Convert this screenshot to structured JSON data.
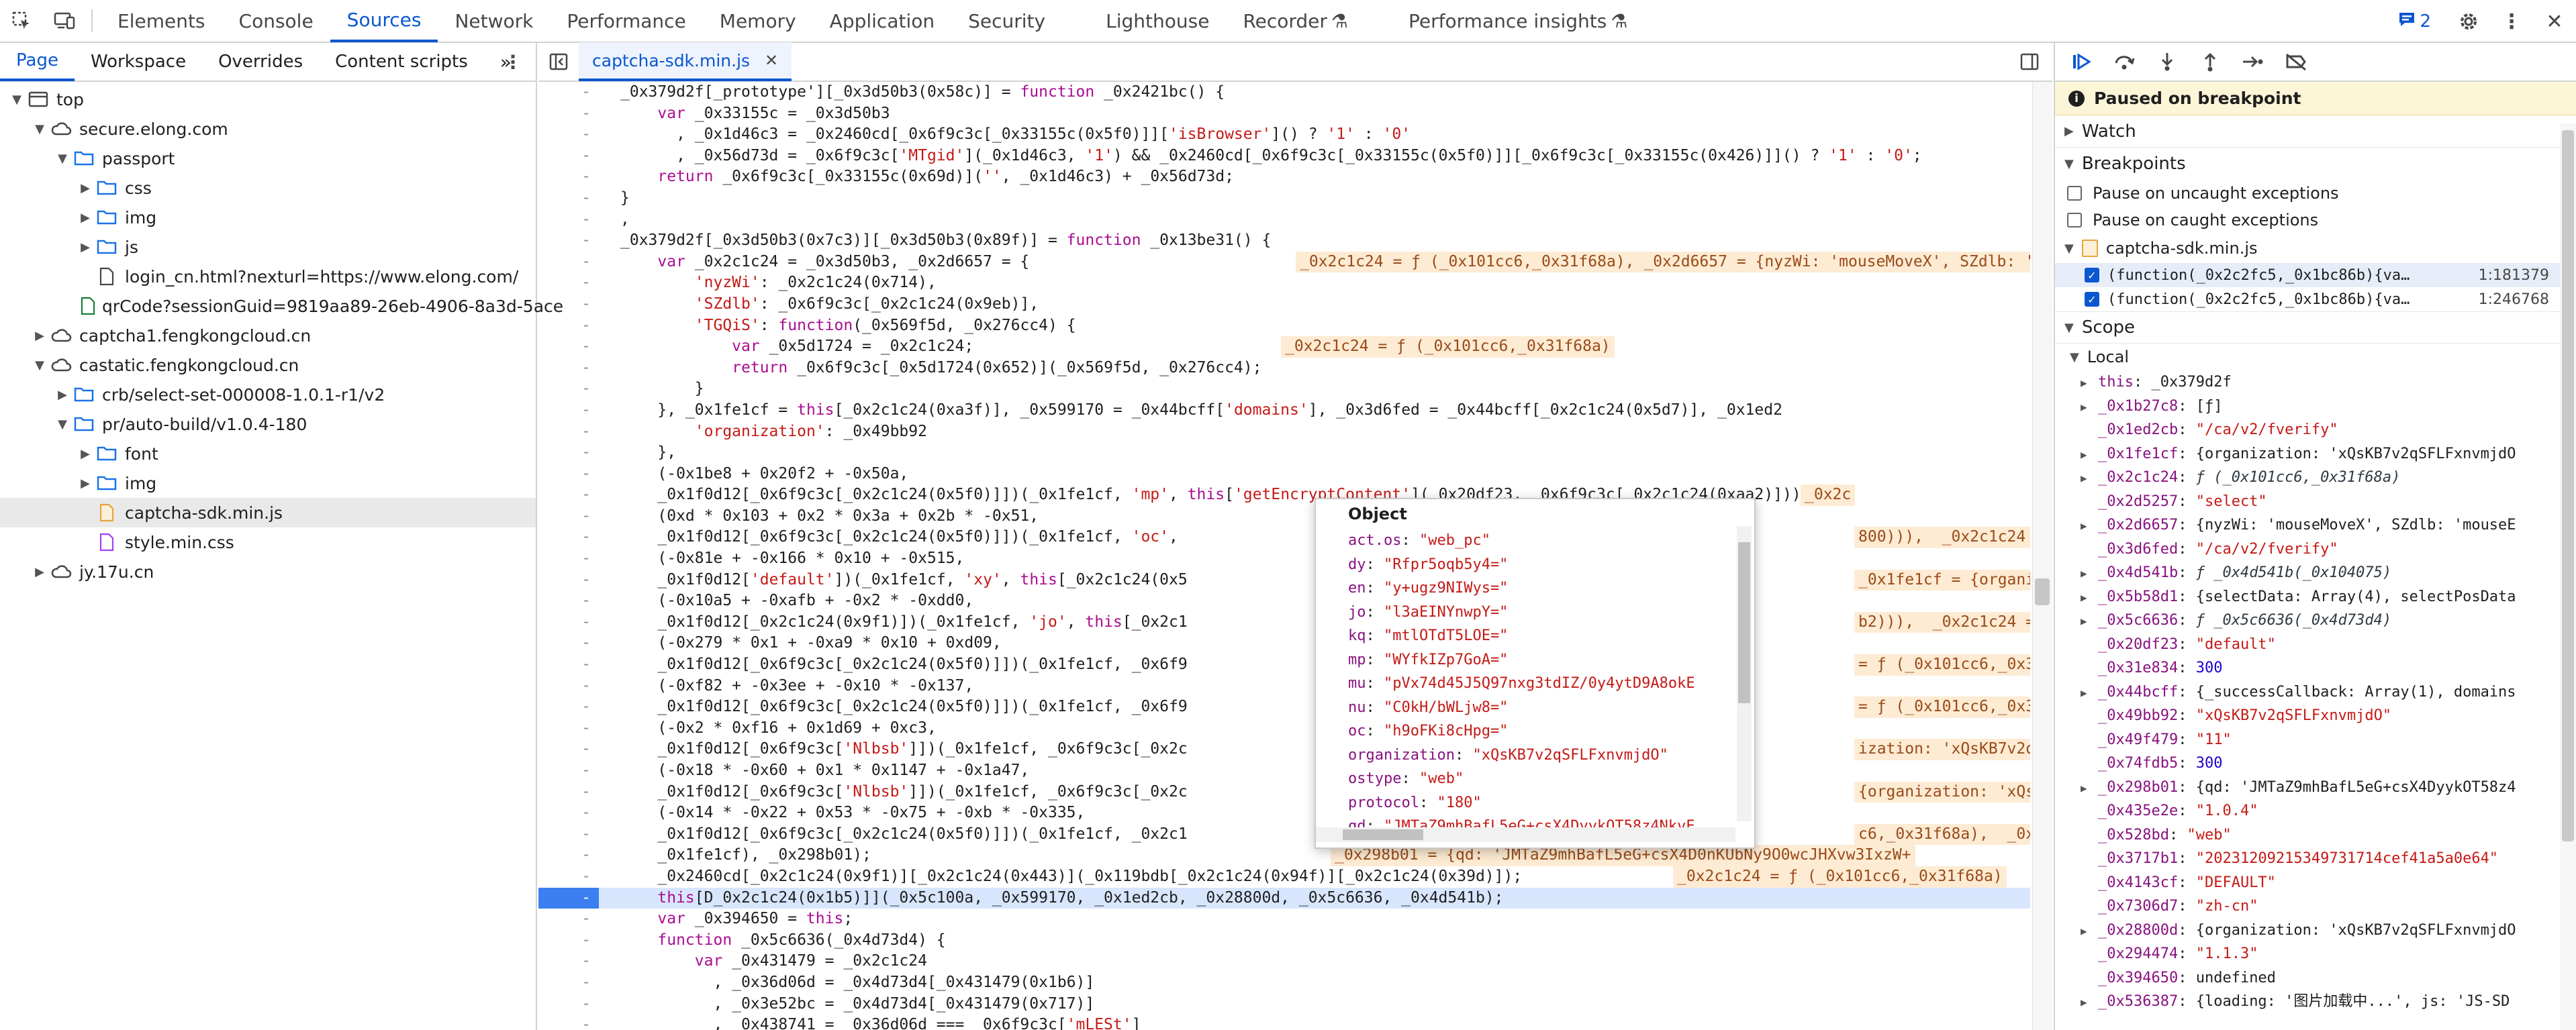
{
  "toolbar": {
    "tabs": [
      "Elements",
      "Console",
      "Sources",
      "Network",
      "Performance",
      "Memory",
      "Application",
      "Security",
      "Lighthouse",
      "Recorder",
      "Performance insights"
    ],
    "active_tab": "Sources",
    "issues_count": "2"
  },
  "navigator": {
    "tabs": [
      "Page",
      "Workspace",
      "Overrides",
      "Content scripts"
    ],
    "tree": [
      {
        "label": "top",
        "depth": 0,
        "arrow": "▼",
        "icon": "frame"
      },
      {
        "label": "secure.elong.com",
        "depth": 1,
        "arrow": "▼",
        "icon": "cloud"
      },
      {
        "label": "passport",
        "depth": 2,
        "arrow": "▼",
        "icon": "folder"
      },
      {
        "label": "css",
        "depth": 3,
        "arrow": "▶",
        "icon": "folder"
      },
      {
        "label": "img",
        "depth": 3,
        "arrow": "▶",
        "icon": "folder"
      },
      {
        "label": "js",
        "depth": 3,
        "arrow": "▶",
        "icon": "folder"
      },
      {
        "label": "login_cn.html?nexturl=https://www.elong.com/",
        "depth": 3,
        "arrow": "",
        "icon": "file"
      },
      {
        "label": "qrCode?sessionGuid=9819aa89-26eb-4906-8a3d-5ace",
        "depth": 3,
        "arrow": "",
        "icon": "file-green"
      },
      {
        "label": "captcha1.fengkongcloud.cn",
        "depth": 1,
        "arrow": "▶",
        "icon": "cloud"
      },
      {
        "label": "castatic.fengkongcloud.cn",
        "depth": 1,
        "arrow": "▼",
        "icon": "cloud"
      },
      {
        "label": "crb/select-set-000008-1.0.1-r1/v2",
        "depth": 2,
        "arrow": "▶",
        "icon": "folder"
      },
      {
        "label": "pr/auto-build/v1.0.4-180",
        "depth": 2,
        "arrow": "▼",
        "icon": "folder"
      },
      {
        "label": "font",
        "depth": 3,
        "arrow": "▶",
        "icon": "folder"
      },
      {
        "label": "img",
        "depth": 3,
        "arrow": "▶",
        "icon": "folder"
      },
      {
        "label": "captcha-sdk.min.js",
        "depth": 3,
        "arrow": "",
        "icon": "file-js",
        "selected": true
      },
      {
        "label": "style.min.css",
        "depth": 3,
        "arrow": "",
        "icon": "file-css"
      },
      {
        "label": "jy.17u.cn",
        "depth": 1,
        "arrow": "▶",
        "icon": "cloud"
      }
    ]
  },
  "editor": {
    "file_tab": "captcha-sdk.min.js",
    "gutter_mark": "-",
    "lines": [
      "_0x379d2f[_prototype'][_0x3d50b3(0x58c)] = function _0x2421bc() {",
      "    var _0x33155c = _0x3d50b3",
      "      , _0x1d46c3 = _0x2460cd[_0x6f9c3c[_0x33155c(0x5f0)]]['isBrowser']() ? '1' : '0'",
      "      , _0x56d73d = _0x6f9c3c['MTgid'](_0x1d46c3, '1') && _0x2460cd[_0x6f9c3c[_0x33155c(0x5f0)]][_0x6f9c3c[_0x33155c(0x426)]]() ? '1' : '0';",
      "    return _0x6f9c3c[_0x33155c(0x69d)]('', _0x1d46c3) + _0x56d73d;",
      "}",
      ",",
      "_0x379d2f[_0x3d50b3(0x7c3)][_0x3d50b3(0x89f)] = function _0x13be31() {",
      "    var _0x2c1c24 = _0x3d50b3, _0x2d6657 = {",
      "        'nyzWi': _0x2c1c24(0x714),",
      "        'SZdlb': _0x6f9c3c[_0x2c1c24(0x9eb)],",
      "        'TGQiS': function(_0x569f5d, _0x276cc4) {",
      "            var _0x5d1724 = _0x2c1c24;",
      "            return _0x6f9c3c[_0x5d1724(0x652)](_0x569f5d, _0x276cc4);",
      "        }",
      "    }, _0x1fe1cf = this[_0x2c1c24(0xa3f)], _0x599170 = _0x44bcff['domains'], _0x3d6fed = _0x44bcff[_0x2c1c24(0x5d7)], _0x1ed2",
      "        'organization': _0x49bb92",
      "    },",
      "    (-0x1be8 + 0x20f2 + -0x50a,",
      "    _0x1f0d12[_0x6f9c3c[_0x2c1c24(0x5f0)]])(_0x1fe1cf, 'mp', this['getEncryptContent'](_0x20df23, _0x6f9c3c[_0x2c1c24(0xaa2)])),",
      "    (0xd * 0x103 + 0x2 * 0x3a + 0x2b * -0x51,",
      "    _0x1f0d12[_0x6f9c3c[_0x2c1c24(0x5f0)]])(_0x1fe1cf, 'oc',",
      "    (-0x81e + -0x166 * 0x10 + -0x515,",
      "    _0x1f0d12['default'])(_0x1fe1cf, 'xy', this[_0x2c1c24(0x5",
      "    (-0x10a5 + -0xafb + -0x2 * -0xdd0,",
      "    _0x1f0d12[_0x2c1c24(0x9f1)])(_0x1fe1cf, 'jo', this[_0x2c1",
      "    (-0x279 * 0x1 + -0xa9 * 0x10 + 0xd09,",
      "    _0x1f0d12[_0x6f9c3c[_0x2c1c24(0x5f0)]])(_0x1fe1cf, _0x6f9",
      "    (-0xf82 + -0x3ee + -0x10 * -0x137,",
      "    _0x1f0d12[_0x6f9c3c[_0x2c1c24(0x5f0)]])(_0x1fe1cf, _0x6f9",
      "    (-0x2 * 0xf16 + 0x1d69 + 0xc3,",
      "    _0x1f0d12[_0x6f9c3c['Nlbsb']])(_0x1fe1cf, _0x6f9c3c[_0x2c",
      "    (-0x18 * -0x60 + 0x1 * 0x1147 + -0x1a47,",
      "    _0x1f0d12[_0x6f9c3c['Nlbsb']])(_0x1fe1cf, _0x6f9c3c[_0x2c",
      "    (-0x14 * -0x22 + 0x53 * -0x75 + -0xb * -0x335,",
      "    _0x1f0d12[_0x6f9c3c[_0x2c1c24(0x5f0)]])(_0x1fe1cf, _0x2c1",
      "    _0x1fe1cf), _0x298b01);",
      "    _0x2460cd[_0x2c1c24(0x9f1)][_0x2c1c24(0x443)](_0x119bdb[_0x2c1c24(0x94f)][_0x2c1c24(0x39d)]);",
      "    this[D_0x2c1c24(0x1b5)]](_0x5c100a, _0x599170, _0x1ed2cb, _0x28800d, _0x5c6636, _0x4d541b);",
      "    var _0x394650 = this;",
      "    function _0x5c6636(_0x4d73d4) {",
      "        var _0x431479 = _0x2c1c24",
      "          , _0x36d06d = _0x4d73d4[_0x431479(0x1b6)]",
      "          , _0x3e52bc = _0x4d73d4[_0x431479(0x717)]",
      "          , _0x438741 = _0x36d06d === _0x6f9c3c['mLESt']"
    ],
    "inline_values": [
      {
        "line": 8,
        "text": "_0x2c1c24 = ƒ (_0x101cc6,_0x31f68a), _0x2d6657 = {nyzWi: 'mouseMoveX', SZdlb: 'mouseEndX'"
      },
      {
        "line": 12,
        "text": "_0x2c1c24 = ƒ (_0x101cc6,_0x31f68a)"
      },
      {
        "line": 19,
        "text": "_0x2c"
      },
      {
        "line": 21,
        "text": "800))),  _0x2c1c24 = ƒ (_0x1"
      },
      {
        "line": 23,
        "text": "_0x1fe1cf = {organization:"
      },
      {
        "line": 25,
        "text": "b2))),  _0x2c1c24 = ƒ (_0x1"
      },
      {
        "line": 27,
        "text": "= ƒ (_0x101cc6,_0x31f68a),  _0x2"
      },
      {
        "line": 29,
        "text": "= ƒ (_0x101cc6,_0x31f68a),  _0x2"
      },
      {
        "line": 31,
        "text": "ization: 'xQsKB7v2qSFLFxnvmjd"
      },
      {
        "line": 33,
        "text": "{organization: 'xQsKB7v2qSFL"
      },
      {
        "line": 35,
        "text": "c6,_0x31f68a),  _0x1fe1cf = {"
      },
      {
        "line": 36,
        "text": "_0x298b01 = {qd: 'JMTaZ9mhBafL5eG+csX4D0nKUbNy9O0wcJHXvw3IxzW+"
      },
      {
        "line": 37,
        "text": "_0x2c1c24 = ƒ (_0x101cc6,_0x31f68a)"
      }
    ]
  },
  "popover": {
    "title": "Object",
    "rows": [
      {
        "k": "act.os",
        "v": "\"web_pc\""
      },
      {
        "k": "dy",
        "v": "\"Rfpr5oqb5y4=\""
      },
      {
        "k": "en",
        "v": "\"y+ugz9NIWys=\""
      },
      {
        "k": "jo",
        "v": "\"l3aEINYnwpY=\""
      },
      {
        "k": "kq",
        "v": "\"mtlOTdT5LOE=\""
      },
      {
        "k": "mp",
        "v": "\"WYfkIZp7GoA=\""
      },
      {
        "k": "mu",
        "v": "\"pVx74d45J5Q97nxg3tdIZ/0y4ytD9A8okE"
      },
      {
        "k": "nu",
        "v": "\"C0kH/bWLjw8=\""
      },
      {
        "k": "oc",
        "v": "\"h9oFKi8cHpg=\""
      },
      {
        "k": "organization",
        "v": "\"xQsKB7v2qSFLFxnvmjdO\""
      },
      {
        "k": "ostype",
        "v": "\"web\""
      },
      {
        "k": "protocol",
        "v": "\"180\""
      },
      {
        "k": "qd",
        "v": "\"JMTaZ9mhBafL5eG+csX4DyykOT58z4NkvE"
      }
    ]
  },
  "debugger": {
    "paused_text": "Paused on breakpoint",
    "watch_label": "Watch",
    "breakpoints_label": "Breakpoints",
    "pause_uncaught": "Pause on uncaught exceptions",
    "pause_caught": "Pause on caught exceptions",
    "bp_file": "captcha-sdk.min.js",
    "bp_entries": [
      {
        "code": "(function(_0x2c2fc5,_0x1bc86b){va…",
        "loc": "1:181379"
      },
      {
        "code": "(function(_0x2c2fc5,_0x1bc86b){va…",
        "loc": "1:246768"
      }
    ],
    "scope_label": "Scope",
    "local_label": "Local",
    "scope": [
      {
        "arrow": "▶",
        "k": "this",
        "v": "_0x379d2f",
        "t": "plain"
      },
      {
        "arrow": "▶",
        "k": "_0x1b27c8",
        "v": "[ƒ]",
        "t": "plain"
      },
      {
        "arrow": "",
        "k": "_0x1ed2cb",
        "v": "\"/ca/v2/fverify\"",
        "t": "str"
      },
      {
        "arrow": "▶",
        "k": "_0x1fe1cf",
        "v": "{organization: 'xQsKB7v2qSFLFxnvmjdO",
        "t": "plain"
      },
      {
        "arrow": "▶",
        "k": "_0x2c1c24",
        "v": "ƒ (_0x101cc6,_0x31f68a)",
        "t": "fn"
      },
      {
        "arrow": "",
        "k": "_0x2d5257",
        "v": "\"select\"",
        "t": "str"
      },
      {
        "arrow": "▶",
        "k": "_0x2d6657",
        "v": "{nyzWi: 'mouseMoveX', SZdlb: 'mouseE",
        "t": "plain"
      },
      {
        "arrow": "",
        "k": "_0x3d6fed",
        "v": "\"/ca/v2/fverify\"",
        "t": "str"
      },
      {
        "arrow": "▶",
        "k": "_0x4d541b",
        "v": "ƒ _0x4d541b(_0x104075)",
        "t": "fn"
      },
      {
        "arrow": "▶",
        "k": "_0x5b58d1",
        "v": "{selectData: Array(4), selectPosData",
        "t": "plain"
      },
      {
        "arrow": "▶",
        "k": "_0x5c6636",
        "v": "ƒ _0x5c6636(_0x4d73d4)",
        "t": "fn"
      },
      {
        "arrow": "",
        "k": "_0x20df23",
        "v": "\"default\"",
        "t": "str"
      },
      {
        "arrow": "",
        "k": "_0x31e834",
        "v": "300",
        "t": "num"
      },
      {
        "arrow": "▶",
        "k": "_0x44bcff",
        "v": "{_successCallback: Array(1), domains",
        "t": "plain"
      },
      {
        "arrow": "",
        "k": "_0x49bb92",
        "v": "\"xQsKB7v2qSFLFxnvmjdO\"",
        "t": "str"
      },
      {
        "arrow": "",
        "k": "_0x49f479",
        "v": "\"11\"",
        "t": "str"
      },
      {
        "arrow": "",
        "k": "_0x74fdb5",
        "v": "300",
        "t": "num"
      },
      {
        "arrow": "▶",
        "k": "_0x298b01",
        "v": "{qd: 'JMTaZ9mhBafL5eG+csX4DyykOT58z4",
        "t": "plain"
      },
      {
        "arrow": "",
        "k": "_0x435e2e",
        "v": "\"1.0.4\"",
        "t": "str"
      },
      {
        "arrow": "",
        "k": "_0x528bd",
        "v": "\"web\"",
        "t": "str"
      },
      {
        "arrow": "",
        "k": "_0x3717b1",
        "v": "\"20231209215349731714cef41a5a0e64\"",
        "t": "str"
      },
      {
        "arrow": "",
        "k": "_0x4143cf",
        "v": "\"DEFAULT\"",
        "t": "str"
      },
      {
        "arrow": "",
        "k": "_0x7306d7",
        "v": "\"zh-cn\"",
        "t": "str"
      },
      {
        "arrow": "▶",
        "k": "_0x28800d",
        "v": "{organization: 'xQsKB7v2qSFLFxnvmjdO",
        "t": "plain"
      },
      {
        "arrow": "",
        "k": "_0x294474",
        "v": "\"1.1.3\"",
        "t": "str"
      },
      {
        "arrow": "",
        "k": "_0x394650",
        "v": "undefined",
        "t": "plain"
      },
      {
        "arrow": "▶",
        "k": "_0x536387",
        "v": "{loading: '图片加载中...', js: 'JS-SD",
        "t": "plain"
      }
    ]
  }
}
